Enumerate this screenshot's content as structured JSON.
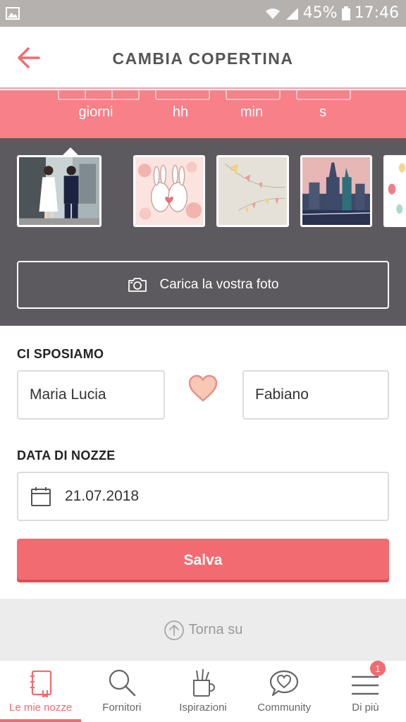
{
  "status_bar": {
    "battery": "45%",
    "time": "17:46"
  },
  "header": {
    "title": "CAMBIA COPERTINA"
  },
  "countdown": {
    "units": [
      "giorni",
      "hh",
      "min",
      "s"
    ]
  },
  "covers": {
    "selected_index": 0
  },
  "upload": {
    "label": "Carica la vostra foto"
  },
  "form": {
    "couple_label": "CI SPOSIAMO",
    "partner1": "Maria Lucia",
    "partner2": "Fabiano",
    "date_label": "DATA DI NOZZE",
    "date": "21.07.2018",
    "save_label": "Salva"
  },
  "back_to_top": "Torna su",
  "nav": {
    "items": [
      "Le mie nozze",
      "Fornitori",
      "Ispirazioni",
      "Community",
      "Di più"
    ],
    "active_index": 0,
    "badge": "1"
  },
  "colors": {
    "accent": "#f26b70",
    "countdown_bg": "#f78089",
    "picker_bg": "#5d5a5f"
  }
}
